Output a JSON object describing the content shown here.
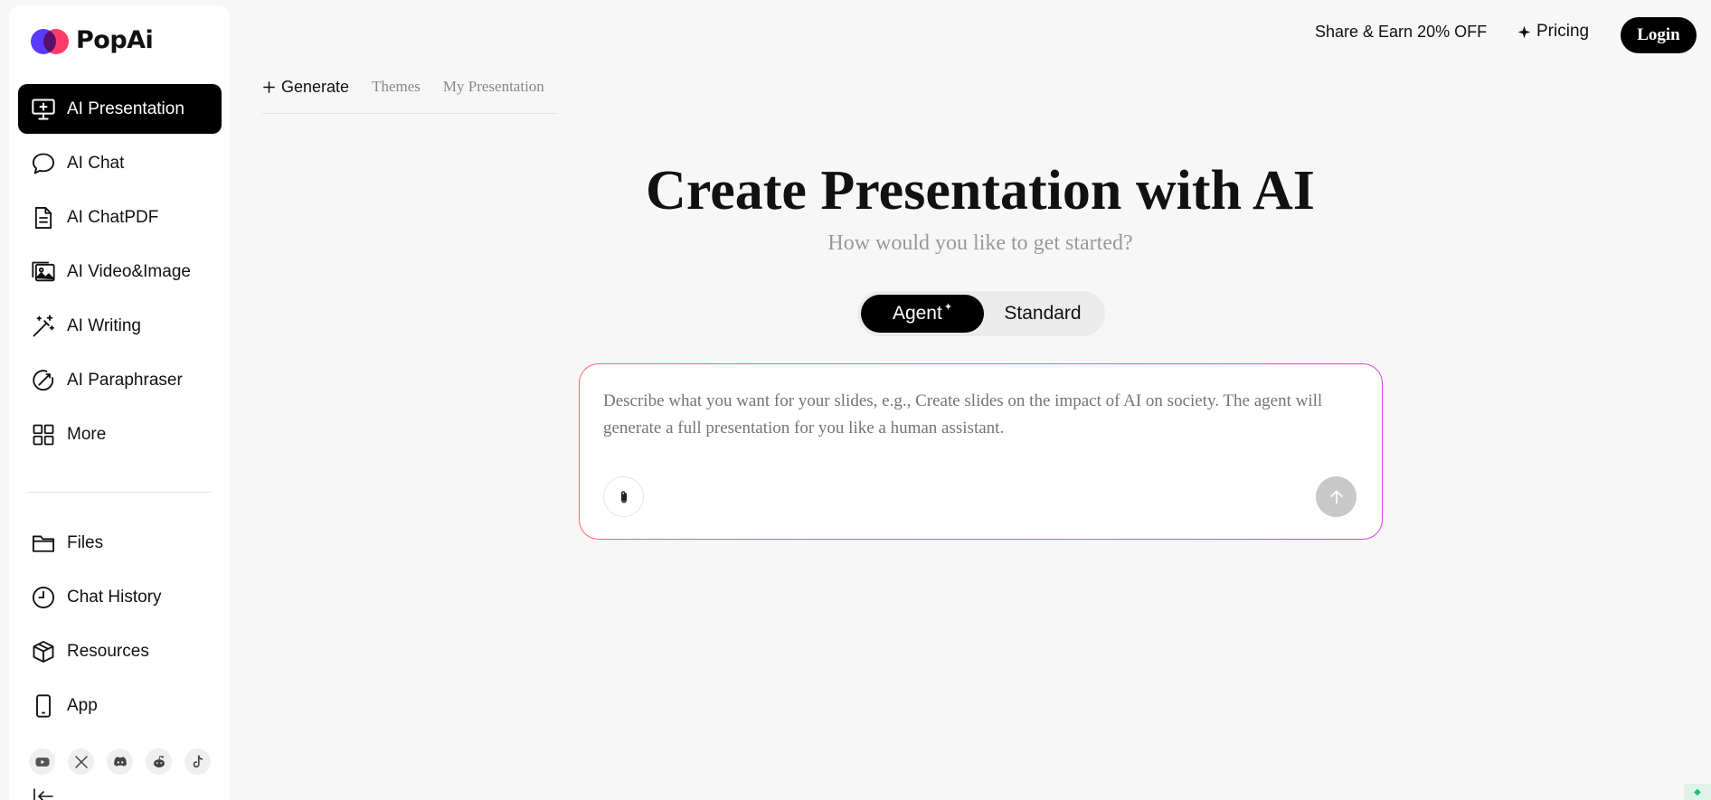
{
  "brand": {
    "name": "PopAi"
  },
  "sidebar": {
    "items": [
      {
        "label": "AI Presentation",
        "icon": "presentation-icon",
        "active": true
      },
      {
        "label": "AI Chat",
        "icon": "chat-bubble-icon"
      },
      {
        "label": "AI ChatPDF",
        "icon": "document-icon"
      },
      {
        "label": "AI Video&Image",
        "icon": "image-gallery-icon"
      },
      {
        "label": "AI Writing",
        "icon": "magic-wand-icon"
      },
      {
        "label": "AI Paraphraser",
        "icon": "paraphraser-icon"
      },
      {
        "label": "More",
        "icon": "grid-icon"
      }
    ],
    "secondary": [
      {
        "label": "Files",
        "icon": "folder-icon"
      },
      {
        "label": "Chat History",
        "icon": "clock-icon"
      },
      {
        "label": "Resources",
        "icon": "cube-icon"
      },
      {
        "label": "App",
        "icon": "phone-icon"
      }
    ],
    "socials": [
      "youtube-icon",
      "x-icon",
      "discord-icon",
      "reddit-icon",
      "tiktok-icon"
    ]
  },
  "header": {
    "share_label": "Share & Earn 20% OFF",
    "pricing_label": "Pricing",
    "login_label": "Login"
  },
  "tabs": {
    "generate": "Generate",
    "themes": "Themes",
    "my_presentation": "My Presentation"
  },
  "main": {
    "title": "Create Presentation with AI",
    "subtitle": "How would you like to get started?",
    "mode_agent": "Agent",
    "mode_standard": "Standard",
    "prompt_placeholder": "Describe what you want for your slides, e.g., Create slides on the impact of AI on society. The agent will generate a full presentation for you like a human assistant."
  },
  "colors": {
    "accent": "#000000",
    "background": "#f7f7f7",
    "gradient_start": "#ff6b6b",
    "gradient_end": "#d147e0"
  }
}
